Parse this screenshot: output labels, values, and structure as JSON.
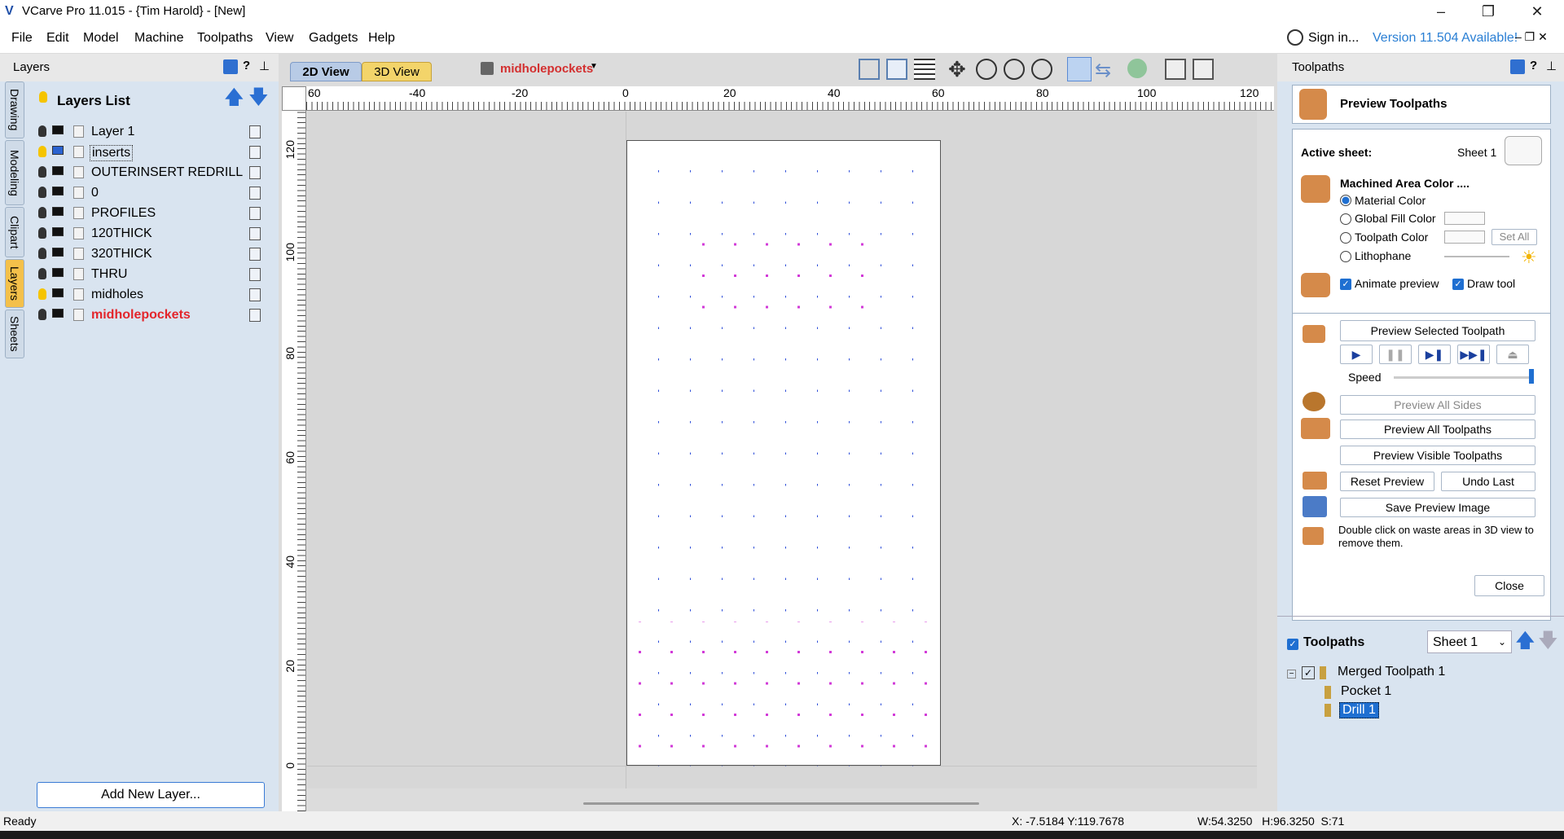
{
  "titlebar": {
    "title": "VCarve Pro 11.015 - {Tim Harold} - [New]"
  },
  "menu": [
    "File",
    "Edit",
    "Model",
    "Machine",
    "Toolpaths",
    "View",
    "Gadgets",
    "Help"
  ],
  "account": {
    "sign_in": "Sign in...",
    "version": "Version 11.504 Available!"
  },
  "layers_panel": {
    "title": "Layers",
    "list_title": "Layers List",
    "vertical_tabs": [
      "Drawing",
      "Modeling",
      "Clipart",
      "Layers",
      "Sheets"
    ],
    "layers": [
      "Layer 1",
      "inserts",
      "OUTERINSERT REDRILL",
      "0",
      "PROFILES",
      "120THICK",
      "320THICK",
      "THRU",
      "midholes",
      "midholepockets"
    ],
    "active_layer_color": "#e3262c",
    "add_button": "Add New Layer..."
  },
  "view": {
    "tab_2d": "2D View",
    "tab_3d": "3D View",
    "current_layer": "midholepockets",
    "ruler_top_labels": [
      "60",
      "-40",
      "-20",
      "0",
      "20",
      "40",
      "60",
      "80",
      "100",
      "120"
    ],
    "ruler_left_labels": [
      "120",
      "100",
      "80",
      "60",
      "40",
      "20",
      "0"
    ]
  },
  "toolpaths_panel": {
    "title": "Toolpaths",
    "preview_title": "Preview Toolpaths",
    "active_sheet_label": "Active sheet:",
    "active_sheet_value": "Sheet 1",
    "machined_area_label": "Machined Area Color ....",
    "options": [
      "Material Color",
      "Global Fill Color",
      "Toolpath Color",
      "Lithophane"
    ],
    "set_all": "Set All",
    "animate_preview": "Animate preview",
    "draw_tool": "Draw tool",
    "preview_selected": "Preview Selected Toolpath",
    "speed_label": "Speed",
    "preview_all_sides": "Preview All Sides",
    "preview_all": "Preview All Toolpaths",
    "preview_visible": "Preview Visible Toolpaths",
    "reset_preview": "Reset Preview",
    "undo_last": "Undo Last",
    "save_preview": "Save Preview Image",
    "hint": "Double click on waste areas in 3D view to remove them.",
    "close": "Close",
    "list_title": "Toolpaths",
    "sheet_select": "Sheet 1",
    "tree": {
      "parent": "Merged Toolpath 1",
      "children": [
        "Pocket 1",
        "Drill 1"
      ]
    }
  },
  "status": {
    "ready": "Ready",
    "coords": "X: -7.5184 Y:119.7678",
    "dims": "W:54.3250   H:96.3250  S:71"
  }
}
